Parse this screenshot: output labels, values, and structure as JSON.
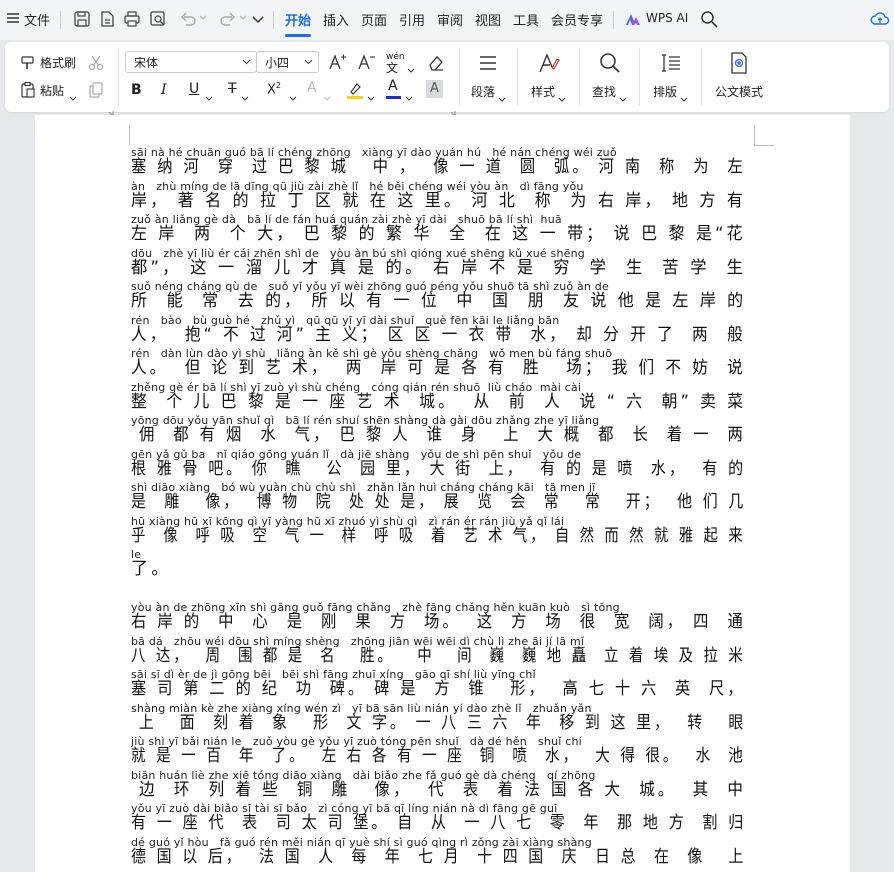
{
  "menubar": {
    "hamburger_label": "文件",
    "tabs": [
      {
        "label": "开始",
        "active": true
      },
      {
        "label": "插入",
        "active": false
      },
      {
        "label": "页面",
        "active": false
      },
      {
        "label": "引用",
        "active": false
      },
      {
        "label": "审阅",
        "active": false
      },
      {
        "label": "视图",
        "active": false
      },
      {
        "label": "工具",
        "active": false
      },
      {
        "label": "会员专享",
        "active": false
      }
    ],
    "wps_ai_label": "WPS AI",
    "accent_color": "#1f6fe5"
  },
  "ribbon": {
    "format_painter": "格式刷",
    "paste": "粘贴",
    "font_name": "宋体",
    "font_size": "小四",
    "pinyin_glyph": "wén",
    "paragraph": "段落",
    "styles": "样式",
    "find": "查找",
    "layout": "排版",
    "official_mode": "公文模式",
    "font_color": "#1a2bd6",
    "highlight_color": "#f2d600"
  },
  "document": {
    "paragraphs": [
      {
        "rows": [
          {
            "py": "sāi nà hé chuān guó bā lí chéng zhōng   xiàng yī dào yuán hú   hé nán chéng wéi zuǒ",
            "hz": "塞 纳 河  穿  过 巴 黎 城   中 ，  像 一 道  圆  弧。 河 南  称  为  左"
          },
          {
            "py": "àn   zhù míng de lā dīng qū jiù zài zhè lǐ   hé běi chéng wéi yòu àn   dì fāng yǒu",
            "hz": "岸， 著 名 的 拉 丁 区 就 在 这 里。 河 北  称  为 右 岸， 地 方 有"
          },
          {
            "py": "zuǒ àn liǎng gè dà   bā lí de fán huá quán zài zhè yī dài   shuō bā lí shì  huā",
            "hz": "左 岸  两  个 大， 巴 黎 的 繁 华  全  在 这 一 带； 说 巴 黎 是“花"
          },
          {
            "py": "dōu   zhè yī liù ér cái zhēn shì de   yòu àn bú shì qióng xué shēng kǔ xué shēng",
            "hz": "都”， 这 一 溜 儿 才 真 是 的。 右 岸 不 是  穷  学  生  苦 学  生"
          },
          {
            "py": "suǒ néng cháng qù de   suǒ yǐ yǒu yī wèi zhōng guó péng yǒu shuō tā shì zuǒ àn de",
            "hz": "所  能  常  去 的， 所 以 有 一 位  中  国  朋  友 说 他 是 左 岸 的"
          },
          {
            "py": "rén   bào   bù guò hé   zhǔ yì   qū qū yī yī dài shuǐ   què fēn kāi le liǎng bān",
            "hz": "人，  抱“ 不 过 河” 主 义； 区 区 一 衣 带  水， 却 分 开 了  两  般"
          },
          {
            "py": "rén   dàn lùn dào yì shù   liǎng àn kě shì gè yǒu shèng chǎng   wǒ men bù fáng shuō",
            "hz": "人。  但 论 到 艺 术，  两  岸 可 是 各 有  胜   场； 我 们 不 妨  说"
          },
          {
            "py": "zhěng gè ér bā lí shì yī zuò yì shù chéng   cóng qián rén shuō  liù cháo  mài cài",
            "hz": "整  个 儿 巴 黎 是 一 座 艺 术  城。  从  前  人  说 “ 六  朝” 卖 菜"
          },
          {
            "py": "yōng dōu yǒu yān shuǐ qì   bā lí rén shuí shēn shàng dà gài dōu zhǎng zhe yī liǎng",
            "hz": " 佣  都 有 烟  水  气， 巴 黎 人  谁  身   上  大 概  都  长  着 一  两"
          },
          {
            "py": "gēn yǎ gǔ ba   nǐ qiáo gōng yuán lǐ   dà jiē shàng   yǒu de shì pēn shuǐ   yǒu de",
            "hz": "根 雅 骨 吧。 你  瞧   公  园 里， 大 街  上，  有 的 是 喷  水，  有 的"
          },
          {
            "py": "shì diāo xiàng   bó wù yuàn chù chù shì   zhǎn lǎn huì cháng cháng kāi   tā men jī",
            "hz": "是  雕   像，  博 物  院  处 处 是， 展  览  会  常   常   开；  他 们 几"
          },
          {
            "py": "hū xiàng hū xī kōng qì yī yàng hū xī zhuó yì shù qì   zì rán ér rán jiù yǎ qǐ lái",
            "hz": "乎  像  呼 吸  空  气 一  样  呼 吸  着  艺 术 气， 自 然 而 然 就 雅 起 来"
          },
          {
            "py": "le",
            "hz": "了。"
          }
        ]
      },
      {
        "rows": [
          {
            "py": "yòu àn de zhōng xīn shì gāng guǒ fāng chǎng   zhè fāng chǎng hěn kuān kuò   sì tōng",
            "hz": "右 岸 的  中  心  是  刚  果  方  场。  这  方  场  很  宽  阔， 四  通"
          },
          {
            "py": "bā dá   zhōu wéi dōu shì míng shèng   zhōng jiān wēi wēi dì chù lì zhe āi jí lā mǐ",
            "hz": "八 达，  周  围 都 是  名   胜。   中   间  巍  巍 地 矗  立 着 埃 及 拉 米"
          },
          {
            "py": "sāi sī dì èr de jì gōng bēi   bēi shì fāng zhuī xíng   gāo qī shí liù yīng chǐ",
            "hz": "塞 司 第 二 的 纪  功  碑。 碑 是  方  锥   形，  高 七 十 六  英  尺，"
          },
          {
            "py": "shàng miàn kè zhe xiàng xíng wén zì   yī bā sān liù nián yí dào zhè lǐ   zhuǎn yǎn",
            "hz": " 上   面  刻 着  象   形  文 字。 一 八 三 六  年  移 到 这 里，  转   眼"
          },
          {
            "py": "jiù shì yī bǎi nián le   zuǒ yòu gè yǒu yī zuò tóng pēn shuǐ   dà dé hěn   shuǐ chí",
            "hz": "就 是 一 百  年  了。  左 右 各 有 一 座  铜  喷  水，  大 得 很。  水  池"
          },
          {
            "py": "biān huán liè zhe xiē tóng diāo xiàng   dài biǎo zhe fǎ guó gè dà chéng   qí zhōng",
            "hz": " 边  环  列 着 些  铜  雕   像，  代  表  着 法 国 各 大  城。  其  中"
          },
          {
            "py": "yǒu yī zuò dài biǎo sī tài sī bǎo   zì cóng yī bā qī líng nián nà dì fāng gē guī",
            "hz": "有 一 座 代  表  司 太 司 堡。 自  从  一 八 七  零  年  那 地 方  割 归"
          },
          {
            "py": "dé guó yǐ hòu   fǎ guó rén měi nián qī yuè shí sì guó qìng rì zǒng zài xiàng shàng",
            "hz": "德 国 以 后，  法 国  人  每  年  七 月  十 四 国  庆  日 总  在  像   上"
          }
        ]
      }
    ]
  }
}
